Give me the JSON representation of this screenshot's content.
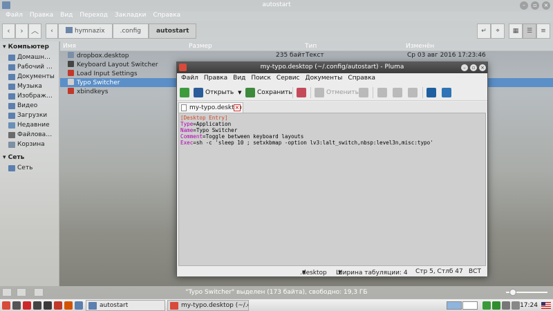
{
  "file_manager": {
    "title": "autostart",
    "menu": [
      "Файл",
      "Правка",
      "Вид",
      "Переход",
      "Закладки",
      "Справка"
    ],
    "breadcrumb": [
      "hymnazix",
      ".config",
      "autostart"
    ],
    "sidebar": {
      "computer_header": "Компьютер",
      "computer_items": [
        {
          "label": "Домашн…",
          "icon": "home-folder-icon",
          "color": "#5b7fae"
        },
        {
          "label": "Рабочий …",
          "icon": "desktop-folder-icon",
          "color": "#5b7fae"
        },
        {
          "label": "Документы",
          "icon": "documents-folder-icon",
          "color": "#5b7fae"
        },
        {
          "label": "Музыка",
          "icon": "music-folder-icon",
          "color": "#5b7fae"
        },
        {
          "label": "Изображ…",
          "icon": "pictures-folder-icon",
          "color": "#5b7fae"
        },
        {
          "label": "Видео",
          "icon": "videos-folder-icon",
          "color": "#5b7fae"
        },
        {
          "label": "Загрузки",
          "icon": "downloads-folder-icon",
          "color": "#5b7fae"
        },
        {
          "label": "Недавние",
          "icon": "recent-icon",
          "color": "#6a8fb8"
        },
        {
          "label": "Файлова…",
          "icon": "filesystem-icon",
          "color": "#6a6a6a"
        },
        {
          "label": "Корзина",
          "icon": "trash-icon",
          "color": "#7d8fa3"
        }
      ],
      "network_header": "Сеть",
      "network_items": [
        {
          "label": "Сеть",
          "icon": "network-icon",
          "color": "#5b7fae"
        }
      ]
    },
    "columns": {
      "name": "Имя",
      "size": "Размер",
      "type": "Тип",
      "modified": "Изменён"
    },
    "files": [
      {
        "name": "dropbox.desktop",
        "size": "235 байт",
        "type": "Текст",
        "modified": "Ср 03 авг 2016 17:23:46",
        "icon_color": "#7a8ea8",
        "selected": false
      },
      {
        "name": "Keyboard Layout Switcher",
        "size": "",
        "type": "",
        "modified": "",
        "icon_color": "#444444",
        "selected": false
      },
      {
        "name": "Load Input Settings",
        "size": "",
        "type": "",
        "modified": "",
        "icon_color": "#c0392b",
        "selected": false
      },
      {
        "name": "Typo Switcher",
        "size": "",
        "type": "",
        "modified": "",
        "icon_color": "#d0d0d0",
        "selected": true
      },
      {
        "name": "xbindkeys",
        "size": "",
        "type": "",
        "modified": "",
        "icon_color": "#c0392b",
        "selected": false
      }
    ],
    "status_text": "\"Typo Switcher\" выделен (173 байта), свободно: 19,3 ГБ"
  },
  "editor": {
    "title": "my-typo.desktop (~/.config/autostart) - Pluma",
    "menu": [
      "Файл",
      "Правка",
      "Вид",
      "Поиск",
      "Сервис",
      "Документы",
      "Справка"
    ],
    "toolbar": {
      "open_label": "Открыть",
      "save_label": "Сохранить",
      "undo_label": "Отменить"
    },
    "tab_label": "my-typo.desktop",
    "lines": [
      {
        "section": "[Desktop Entry]",
        "key": "",
        "value": ""
      },
      {
        "section": "",
        "key": "Type",
        "value": "=Application"
      },
      {
        "section": "",
        "key": "Name",
        "value": "=Typo Switcher"
      },
      {
        "section": "",
        "key": "Comment",
        "value": "=Toggle between keyboard layouts"
      },
      {
        "section": "",
        "key": "Exec",
        "value": "=sh -c 'sleep 10 ; setxkbmap -option lv3:lalt_switch,nbsp:level3n,misc:typo'"
      }
    ],
    "status": {
      "language": ".desktop",
      "tab_width": "Ширина табуляции:  4",
      "position": "Стр 5, Стлб 47",
      "mode": "ВСТ"
    }
  },
  "panel": {
    "tasks": [
      {
        "label": "autostart",
        "active": false,
        "icon_color": "#5b7fae"
      },
      {
        "label": "my-typo.desktop (~/.co…",
        "active": true,
        "icon_color": "#d84a3a"
      }
    ],
    "clock": "17:24"
  }
}
